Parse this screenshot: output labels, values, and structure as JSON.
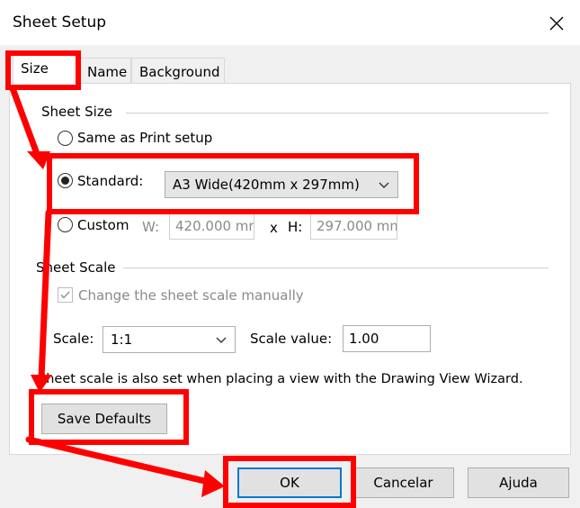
{
  "window": {
    "title": "Sheet Setup"
  },
  "tabs": [
    {
      "label": "Size",
      "active": true
    },
    {
      "label": "Name",
      "active": false
    },
    {
      "label": "Background",
      "active": false
    }
  ],
  "sheet_size": {
    "group_label": "Sheet Size",
    "option_print": "Same as Print setup",
    "option_standard": "Standard:",
    "standard_value": "A3 Wide(420mm x 297mm)",
    "option_custom": "Custom",
    "w_label": "W:",
    "w_value": "420.000 mm",
    "x_label": "x",
    "h_label": "H:",
    "h_value": "297.000 mm",
    "selected": "standard"
  },
  "sheet_scale": {
    "group_label": "Sheet Scale",
    "manual_label": "Change the sheet scale manually",
    "manual_checked": true,
    "scale_label": "Scale:",
    "scale_value": "1:1",
    "scale_value_label": "Scale value:",
    "scale_value_input": "1.00",
    "note": "Sheet scale is also set when placing a view with the Drawing View Wizard."
  },
  "buttons": {
    "save_defaults": "Save Defaults",
    "ok": "OK",
    "cancel": "Cancelar",
    "help": "Ajuda"
  },
  "annotation_color": "#ff0000"
}
